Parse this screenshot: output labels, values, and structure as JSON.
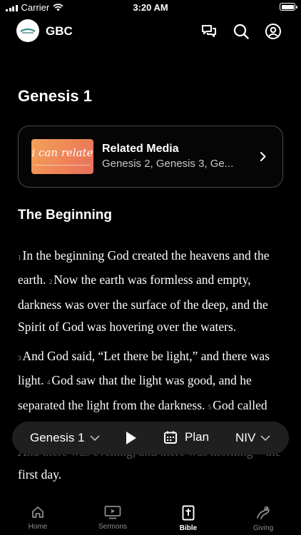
{
  "status_bar": {
    "carrier": "Carrier",
    "time": "3:20 AM"
  },
  "header": {
    "org_name": "GBC",
    "icons": [
      "chat-icon",
      "search-icon",
      "profile-icon"
    ]
  },
  "page": {
    "title": "Genesis 1",
    "related_media": {
      "thumbnail_text": "i can relate",
      "title": "Related Media",
      "subtitle": "Genesis 2, Genesis 3, Ge..."
    },
    "section_heading": "The Beginning",
    "paragraphs": [
      {
        "verses": [
          {
            "num": "1",
            "text": "In the beginning God created the heavens and the earth. "
          },
          {
            "num": "2",
            "text": "Now the earth was formless and empty, darkness was over the surface of the deep, and the Spirit of God was hovering over the waters."
          }
        ]
      },
      {
        "verses": [
          {
            "num": "3",
            "text": "And God said, “Let there be light,” and there was light. "
          },
          {
            "num": "4",
            "text": "God saw that the light was good, and he separated the light from the darkness. "
          },
          {
            "num": "5",
            "text": "God called the light “day,” and the darkness he called “night.” And there was evening, and there was morning—the first day."
          }
        ]
      }
    ]
  },
  "toolbar": {
    "chapter": "Genesis 1",
    "plan_label": "Plan",
    "version": "NIV"
  },
  "tabbar": {
    "tabs": [
      {
        "label": "Home",
        "icon": "home-icon"
      },
      {
        "label": "Sermons",
        "icon": "video-icon"
      },
      {
        "label": "Bible",
        "icon": "bible-icon",
        "active": true
      },
      {
        "label": "Giving",
        "icon": "giving-icon"
      }
    ]
  },
  "colors": {
    "background": "#000000",
    "card_border": "#4a4a4a",
    "toolbar_bg": "#1f1f1f",
    "inactive_tab": "#8d8d8d"
  }
}
